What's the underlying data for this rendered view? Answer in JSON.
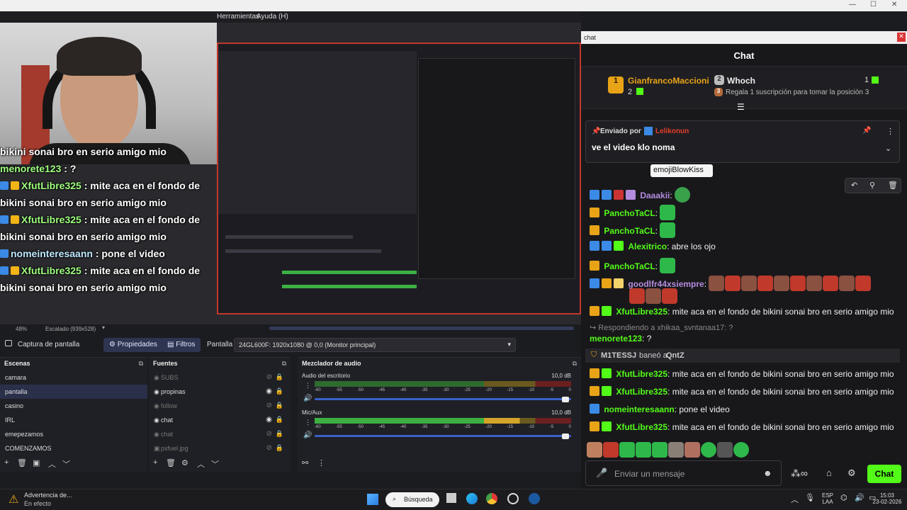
{
  "menubar": {
    "items": [
      "Herramientas",
      "Ayuda (H)"
    ]
  },
  "overlay_chat": [
    {
      "user": "",
      "text": "bikini sonai bro en serio amigo mio"
    },
    {
      "user": "menorete123",
      "text": " : ?"
    },
    {
      "user": "XfutLibre325",
      "text": " : mite aca en el fondo de"
    },
    {
      "user": "",
      "text": "bikini sonai bro en serio amigo mio"
    },
    {
      "user": "XfutLibre325",
      "text": " : mite aca en el fondo de"
    },
    {
      "user": "",
      "text": "bikini sonai bro en serio amigo mio"
    },
    {
      "user": "nomeinteresaann",
      "text": " : pone el video"
    },
    {
      "user": "XfutLibre325",
      "text": " : mite aca en el fondo de"
    },
    {
      "user": "",
      "text": "bikini sonai bro en serio amigo mio"
    }
  ],
  "zoombar": {
    "zoom": "48%",
    "scaled": "Escalado (939x528)"
  },
  "propbar": {
    "source_name": "Captura de pantalla",
    "properties_label": "Propiedades",
    "filters_label": "Filtros",
    "display_label": "Pantalla",
    "display_value": "24GL600F: 1920x1080 @ 0,0 (Monitor principal)"
  },
  "scenes": {
    "title": "Escenas",
    "items": [
      "camara",
      "pantalla",
      "casino",
      "IRL",
      "emepezamos",
      "COMENZAMOS"
    ]
  },
  "sources": {
    "title": "Fuentes",
    "items": [
      "SUBS",
      "propinas",
      "follow",
      "chat",
      "chat",
      "pxfuel.jpg"
    ]
  },
  "mixer": {
    "title": "Mezclador de audio",
    "tracks": [
      {
        "name": "Audio del escritorio",
        "db": "10,0 dB"
      },
      {
        "name": "Mic/Aux",
        "db": "10,0 dB"
      }
    ],
    "scale": [
      "-60",
      "-55",
      "-50",
      "-45",
      "-40",
      "-35",
      "-30",
      "-25",
      "-20",
      "-15",
      "-10",
      "-5",
      "0"
    ]
  },
  "chat": {
    "window_title": "chat",
    "header": "Chat",
    "leader1": {
      "name": "GianfrancoMaccioni",
      "count": "2",
      "rank": "1"
    },
    "leader2": {
      "name": "Whoch",
      "count": "1",
      "rank": "2"
    },
    "leader3": {
      "text": "Regala 1 suscripción para tomar la posición 3",
      "rank": "3"
    },
    "pinned": {
      "prefix": "Enviado por",
      "user": "Lelikonun",
      "text": "ve el video klo noma"
    },
    "tooltip": "emojiBlowKiss",
    "messages": [
      {
        "user": "Daaakii",
        "text": ":"
      },
      {
        "user": "PanchoTaCL",
        "text": ":"
      },
      {
        "user": "PanchoTaCL",
        "text": ":"
      },
      {
        "user": "Alexitrico",
        "text": ": abre los ojo"
      },
      {
        "user": "PanchoTaCL",
        "text": ":"
      },
      {
        "user": "goodlfr44xsiempre",
        "text": ":"
      },
      {
        "user": "XfutLibre325",
        "text": ": mite aca en el fondo de bikini sonai bro en serio amigo mio"
      }
    ],
    "reply_to": "Respondiendo a xhikaa_svntanaa17: ?",
    "reply_msg": {
      "user": "menorete123",
      "text": ": ?"
    },
    "ban": {
      "user": "M1TESSJ",
      "action": "baneó a",
      "target": "QntZ"
    },
    "messages2": [
      {
        "user": "XfutLibre325",
        "text": ": mite aca en el fondo de bikini sonai bro en serio amigo mio"
      },
      {
        "user": "XfutLibre325",
        "text": ": mite aca en el fondo de bikini sonai bro en serio amigo mio"
      },
      {
        "user": "nomeinteresaann",
        "text": ": pone el video"
      },
      {
        "user": "XfutLibre325",
        "text": ": mite aca en el fondo de bikini sonai bro en serio amigo mio"
      }
    ],
    "input_placeholder": "Enviar un mensaje",
    "send_label": "Chat"
  },
  "taskbar": {
    "warning_title": "Advertencia de...",
    "warning_sub": "En efecto",
    "search": "Búsqueda",
    "lang1": "ESP",
    "lang2": "LAA",
    "time": "15:03",
    "date": "23-02-2026"
  },
  "colors": {
    "accent": "#53fc18",
    "obs_select": "#2a2f4a",
    "kick_bg": "#18181b"
  }
}
